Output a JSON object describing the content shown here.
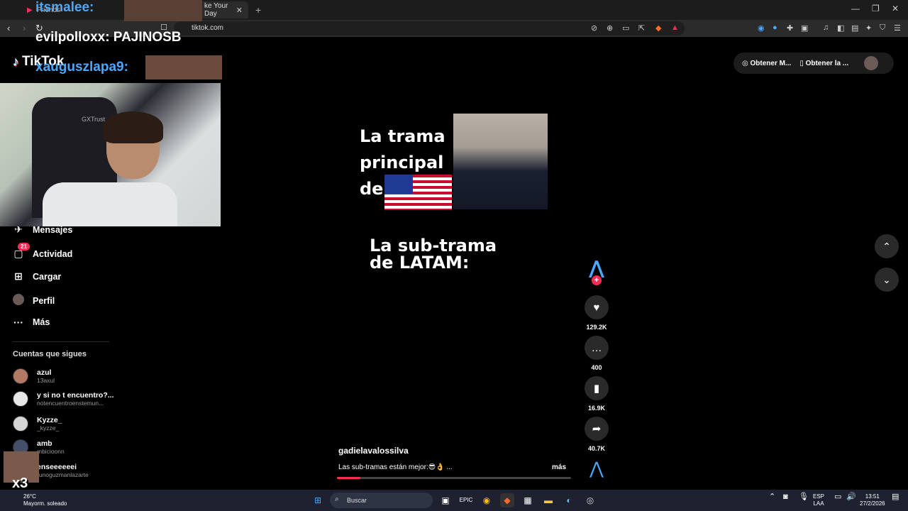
{
  "browser": {
    "tab_partial_left": "Friends",
    "tab_title": "ke Your Day",
    "tab_close": "✕",
    "new_tab": "+",
    "url": "tiktok.com",
    "win_min": "—",
    "win_max": "❐",
    "win_close": "✕"
  },
  "tiktok": {
    "logo_text": "TikTok",
    "sidebar": [
      {
        "label": "Mensajes",
        "badge": ""
      },
      {
        "label": "Actividad",
        "badge": "21"
      },
      {
        "label": "Cargar",
        "badge": ""
      },
      {
        "label": "Perfil",
        "badge": ""
      },
      {
        "label": "Más",
        "badge": ""
      }
    ],
    "following_heading": "Cuentas que sigues",
    "following": [
      {
        "name": "azul",
        "handle": "13axul"
      },
      {
        "name": "y si no t encuentro?...",
        "handle": "notencuentroenstemun..."
      },
      {
        "name": "Kyzze_",
        "handle": "_kyzze_"
      },
      {
        "name": "amb",
        "handle": "mbicioonn"
      },
      {
        "name": "enseeeeeei",
        "handle": "runoguzmanlazarte"
      }
    ],
    "video": {
      "line1": "La trama",
      "line2": "principal",
      "line3": "de",
      "sub1": "La sub-trama",
      "sub2": "de LATAM:",
      "author": "gadielavalossilva",
      "description": "Las sub-tramas están mejor:😎👌 ...",
      "more": "más",
      "progress": 0.1
    },
    "actions": {
      "likes": "129.2K",
      "comments": "400",
      "saves": "16.9K",
      "shares": "40.7K"
    },
    "top_right": {
      "coins": "Obtener M...",
      "app": "Obtener la ..."
    }
  },
  "overlay": {
    "chat1_user": "itsmalee:",
    "chat2": "evilpolloxx: PAJINOSB",
    "chat3_user": "xauguszlapa9:",
    "combo": "x3",
    "cam_brand": "GXTrust"
  },
  "taskbar": {
    "temp": "26°C",
    "weather": "Mayorm. soleado",
    "search": "Buscar",
    "lang1": "ESP",
    "lang2": "LAA",
    "time": "13:51",
    "date": "27/2/2026"
  },
  "colors": {
    "accent": "#fe2c55",
    "cyan": "#25f4ee",
    "chat_purple": "#c9a3ff",
    "chat_blue": "#4aa8ff"
  }
}
